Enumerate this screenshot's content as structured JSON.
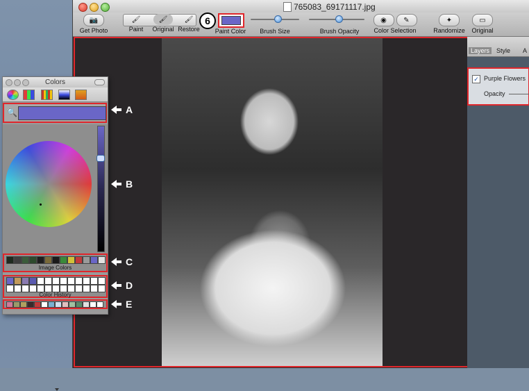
{
  "window": {
    "title": "765083_69171117.jpg"
  },
  "toolbar": {
    "get_photo": "Get Photo",
    "paint": "Paint",
    "original": "Original",
    "restore": "Restore",
    "paint_color": "Paint Color",
    "brush_size": "Brush Size",
    "brush_opacity": "Brush Opacity",
    "color_selection": "Color Selection",
    "randomize": "Randomize",
    "original2": "Original",
    "step_badge": "6",
    "paint_color_value": "#6a66c7"
  },
  "right_panel": {
    "tab_layers": "Layers",
    "tab_style": "Style",
    "tab_more": "A",
    "layer_name": "Purple Flowers",
    "layer_checked": "✓",
    "opacity_label": "Opacity"
  },
  "colors_panel": {
    "title": "Colors",
    "current_color": "#6a66c7",
    "image_colors_label": "Image Colors",
    "color_history_label": "Color History",
    "image_colors": [
      "#1f2a1f",
      "#3e3e3e",
      "#3b5b3b",
      "#2d4a2d",
      "#1e1e1e",
      "#7a6a3a",
      "#1a1a1a",
      "#3a8a3a",
      "#d2c23a",
      "#c23a3a",
      "#9a9a9a",
      "#6a66c7",
      "#e0e0e0"
    ],
    "history_row1": [
      "#6a66c7",
      "#c29a5a",
      "#8a7ab0",
      "#5a5ab0",
      "#ffffff",
      "#ffffff",
      "#ffffff",
      "#ffffff",
      "#ffffff",
      "#ffffff",
      "#ffffff",
      "#ffffff",
      "#ffffff"
    ],
    "history_row2": [
      "#ffffff",
      "#ffffff",
      "#ffffff",
      "#ffffff",
      "#ffffff",
      "#ffffff",
      "#ffffff",
      "#ffffff",
      "#ffffff",
      "#ffffff",
      "#ffffff",
      "#ffffff",
      "#ffffff"
    ],
    "favorites": [
      "#d07a9a",
      "#9a9a6a",
      "#b0a060",
      "#3a2a2a",
      "#c03a3a",
      "#ffffff",
      "#7ab0d0",
      "#d0e0f0",
      "#e0c0c0",
      "#a0c0a0",
      "#5a8a6a",
      "#e0e0e0",
      "#ffffff",
      "#ffffff"
    ]
  },
  "callouts": {
    "a": "A",
    "b": "B",
    "c": "C",
    "d": "D",
    "e": "E"
  },
  "colors": {
    "highlight": "#e0262b",
    "canvas_bg": "#2a2729"
  }
}
